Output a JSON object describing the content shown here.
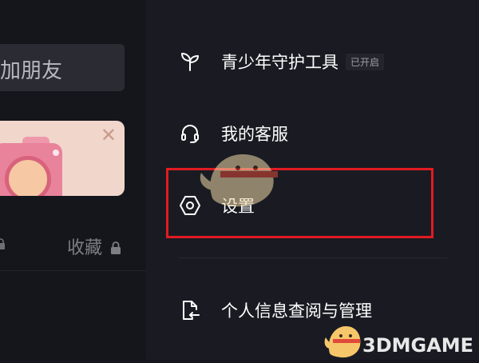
{
  "left_panel": {
    "add_friend_label": "加朋友",
    "promo_close": "✕",
    "favorites_label": "收藏"
  },
  "drawer": {
    "items": [
      {
        "label": "青少年守护工具",
        "badge": "已开启",
        "icon": "sprout-icon"
      },
      {
        "label": "我的客服",
        "icon": "headset-icon"
      },
      {
        "label": "设置",
        "icon": "settings-hexagon-icon"
      },
      {
        "label": "个人信息查阅与管理",
        "icon": "document-arrow-icon"
      }
    ]
  },
  "watermark": {
    "text": "3DMGAME"
  },
  "colors": {
    "background": "#16171e",
    "drawer": "#1a1b22",
    "highlight": "#e11b22",
    "text": "#ffffff"
  }
}
